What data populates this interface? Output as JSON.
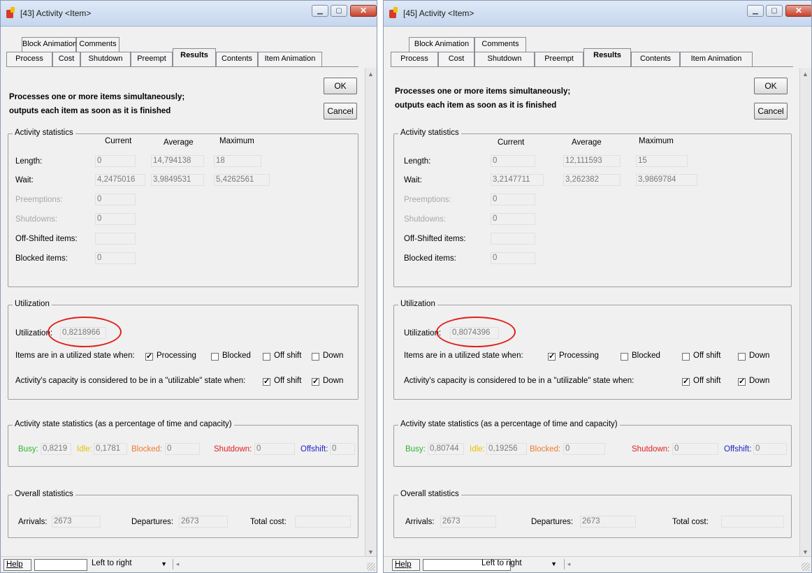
{
  "left": {
    "title": "[43]  Activity  <Item>",
    "tabs": {
      "block_animation": "Block Animation",
      "comments": "Comments",
      "process": "Process",
      "cost": "Cost",
      "shutdown": "Shutdown",
      "preempt": "Preempt",
      "results": "Results",
      "contents": "Contents",
      "item_animation": "Item Animation"
    },
    "description": [
      "Processes one or more items simultaneously;",
      "outputs each item as soon as it is finished"
    ],
    "ok": "OK",
    "cancel": "Cancel",
    "activity_stats": {
      "title": "Activity statistics",
      "headers": [
        "Current",
        "Average",
        "Maximum"
      ],
      "length_label": "Length:",
      "length": [
        "0",
        "14,794138",
        "18"
      ],
      "wait_label": "Wait:",
      "wait": [
        "4,2475016",
        "3,9849531",
        "5,4262561"
      ],
      "preemptions_label": "Preemptions:",
      "preemptions": "0",
      "shutdowns_label": "Shutdowns:",
      "shutdowns": "0",
      "offshifted_label": "Off-Shifted items:",
      "offshifted": "",
      "blocked_label": "Blocked items:",
      "blocked": "0"
    },
    "utilization": {
      "title": "Utilization",
      "label": "Utilization:",
      "value": "0,8218966",
      "state_label": "Items are in a utilized state when:",
      "processing": "Processing",
      "blocked": "Blocked",
      "offshift": "Off shift",
      "down": "Down",
      "capacity_label": "Activity's capacity is considered to be in a \"utilizable\" state when:",
      "cap_offshift": "Off shift",
      "cap_down": "Down",
      "check": "✓"
    },
    "state_stats": {
      "title": "Activity state statistics (as a percentage of time and capacity)",
      "busy_label": "Busy:",
      "busy": "0,8219",
      "idle_label": "Idle:",
      "idle": "0,1781",
      "blocked_label": "Blocked:",
      "blocked": "0",
      "shutdown_label": "Shutdown:",
      "shutdown": "0",
      "offshift_label": "Offshift:",
      "offshift": "0"
    },
    "overall": {
      "title": "Overall statistics",
      "arrivals_label": "Arrivals:",
      "arrivals": "2673",
      "departures_label": "Departures:",
      "departures": "2673",
      "total_cost_label": "Total cost:",
      "total_cost": ""
    },
    "status": {
      "help": "Help",
      "flow": "Left to right"
    }
  },
  "right": {
    "title": "[45]  Activity  <Item>",
    "tabs": {
      "block_animation": "Block Animation",
      "comments": "Comments",
      "process": "Process",
      "cost": "Cost",
      "shutdown": "Shutdown",
      "preempt": "Preempt",
      "results": "Results",
      "contents": "Contents",
      "item_animation": "Item Animation"
    },
    "description": [
      "Processes one or more items simultaneously;",
      "outputs each item as soon as it is finished"
    ],
    "ok": "OK",
    "cancel": "Cancel",
    "activity_stats": {
      "title": "Activity statistics",
      "headers": [
        "Current",
        "Average",
        "Maximum"
      ],
      "length_label": "Length:",
      "length": [
        "0",
        "12,111593",
        "15"
      ],
      "wait_label": "Wait:",
      "wait": [
        "3,2147711",
        "3,262382",
        "3,9869784"
      ],
      "preemptions_label": "Preemptions:",
      "preemptions": "0",
      "shutdowns_label": "Shutdowns:",
      "shutdowns": "0",
      "offshifted_label": "Off-Shifted items:",
      "offshifted": "",
      "blocked_label": "Blocked items:",
      "blocked": "0"
    },
    "utilization": {
      "title": "Utilization",
      "label": "Utilization:",
      "value": "0,8074396",
      "state_label": "Items are in a utilized state when:",
      "processing": "Processing",
      "blocked": "Blocked",
      "offshift": "Off shift",
      "down": "Down",
      "capacity_label": "Activity's capacity is considered to be in a \"utilizable\" state when:",
      "cap_offshift": "Off shift",
      "cap_down": "Down",
      "check": "✓"
    },
    "state_stats": {
      "title": "Activity state statistics (as a percentage of time and capacity)",
      "busy_label": "Busy:",
      "busy": "0,80744",
      "idle_label": "Idle:",
      "idle": "0,19256",
      "blocked_label": "Blocked:",
      "blocked": "0",
      "shutdown_label": "Shutdown:",
      "shutdown": "0",
      "offshift_label": "Offshift:",
      "offshift": "0"
    },
    "overall": {
      "title": "Overall statistics",
      "arrivals_label": "Arrivals:",
      "arrivals": "2673",
      "departures_label": "Departures:",
      "departures": "2673",
      "total_cost_label": "Total cost:",
      "total_cost": ""
    },
    "status": {
      "help": "Help",
      "flow": "Left to right"
    }
  },
  "colors": {
    "busy": "#2db52d",
    "idle": "#e8c200",
    "blocked": "#f07a2a",
    "shutdown": "#e02020",
    "offshift": "#2020c8",
    "highlight_circle": "#e0201a"
  }
}
